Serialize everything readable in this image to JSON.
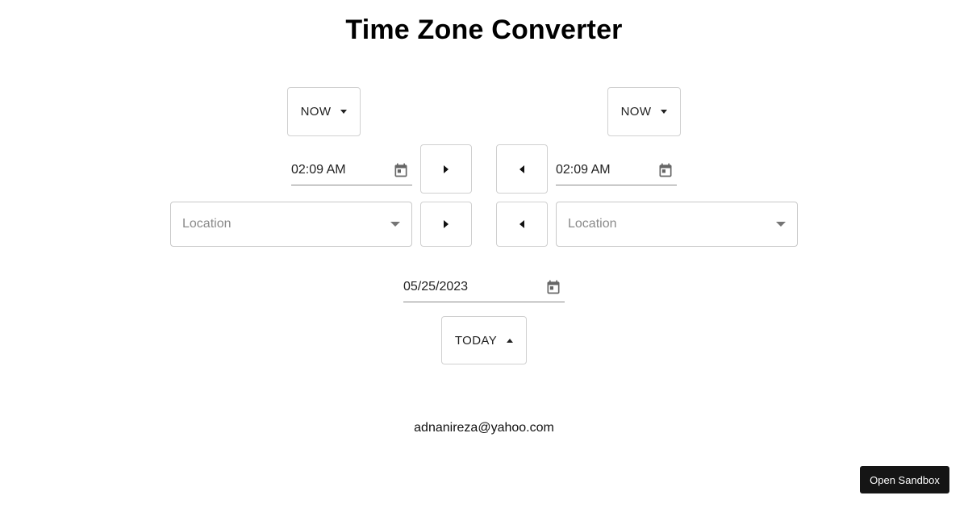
{
  "page": {
    "title": "Time Zone Converter"
  },
  "left": {
    "mode_label": "NOW",
    "time_value": "02:09 AM",
    "location_placeholder": "Location"
  },
  "right": {
    "mode_label": "NOW",
    "time_value": "02:09 AM",
    "location_placeholder": "Location"
  },
  "date": {
    "value": "05/25/2023",
    "mode_label": "TODAY"
  },
  "footer": {
    "email": "adnanireza@yahoo.com",
    "sandbox_label": "Open Sandbox"
  },
  "icons": {
    "calendar": "calendar-icon",
    "caret_down": "caret-down-icon",
    "caret_up": "caret-up-icon",
    "arrow_right": "arrow-right-icon",
    "arrow_left": "arrow-left-icon"
  },
  "colors": {
    "sandbox_bg": "#151515",
    "border": "#d0d0d0",
    "placeholder": "#8a8a8a"
  }
}
